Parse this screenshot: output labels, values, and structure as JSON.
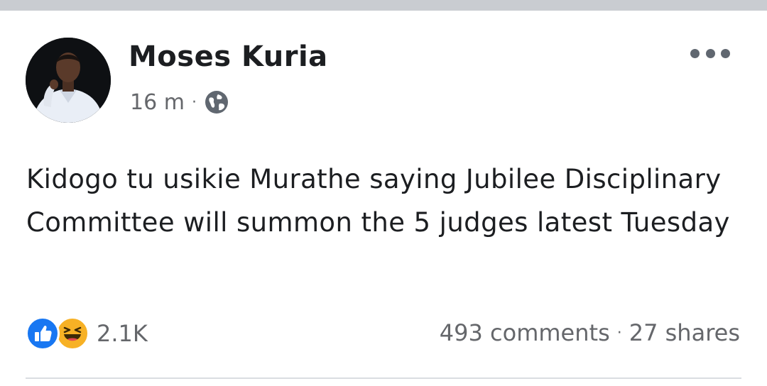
{
  "post": {
    "author": "Moses Kuria",
    "time": "16 m",
    "meta_separator": "·",
    "privacy_icon": "globe-icon",
    "more_icon": "more-options-icon",
    "text": "Kidogo tu usikie Murathe saying Jubilee Disciplinary Committee will summon the 5 judges latest Tuesday"
  },
  "reactions": {
    "icons": [
      "like-icon",
      "haha-icon"
    ],
    "count": "2.1K"
  },
  "stats": {
    "comments": "493 comments",
    "separator": "·",
    "shares": "27 shares"
  },
  "colors": {
    "top_bar": "#c9ccd1",
    "like": "#1877f2",
    "haha": "#f7b125",
    "muted_text": "#65676b",
    "primary_text": "#1c1e21"
  }
}
